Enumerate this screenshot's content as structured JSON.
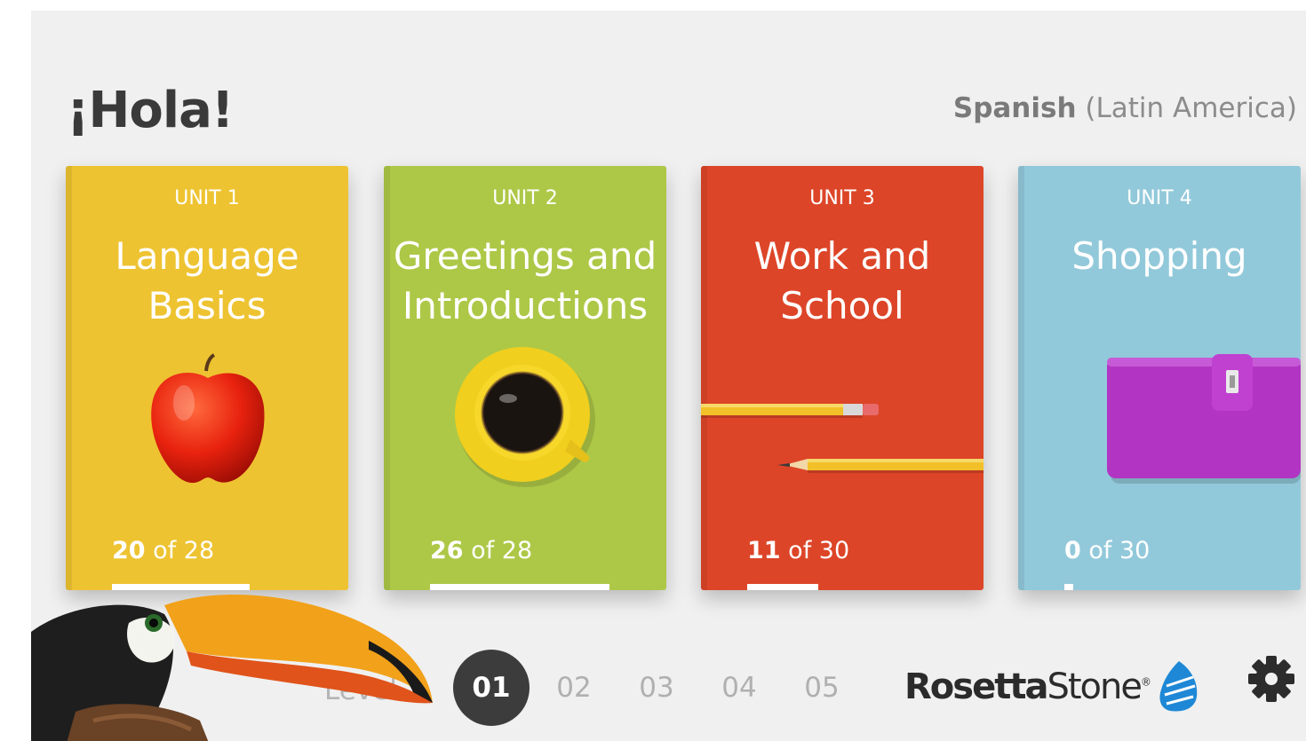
{
  "header": {
    "greeting": "¡Hola!",
    "language_name": "Spanish",
    "language_variant": "(Latin America)"
  },
  "units": [
    {
      "unit_label": "UNIT 1",
      "title_line1": "Language",
      "title_line2": "Basics",
      "completed": "20",
      "of_label": "of 28",
      "progress_fraction": 0.714,
      "color": "#eec331",
      "art": "apple-image"
    },
    {
      "unit_label": "UNIT 2",
      "title_line1": "Greetings and",
      "title_line2": "Introductions",
      "completed": "26",
      "of_label": "of 28",
      "progress_fraction": 0.929,
      "color": "#adc847",
      "art": "coffee-cup-image"
    },
    {
      "unit_label": "UNIT 3",
      "title_line1": "Work and",
      "title_line2": "School",
      "completed": "11",
      "of_label": "of 30",
      "progress_fraction": 0.367,
      "color": "#dd4528",
      "art": "pencils-image"
    },
    {
      "unit_label": "UNIT 4",
      "title_line1": "Shopping",
      "title_line2": "",
      "completed": "0",
      "of_label": "of 30",
      "progress_fraction": 0.0,
      "color": "#92c9da",
      "art": "wallet-image"
    }
  ],
  "levels": {
    "label": "Level",
    "items": [
      "01",
      "02",
      "03",
      "04",
      "05"
    ],
    "selected": "01"
  },
  "branding": {
    "logo_text_bold": "Rosetta",
    "logo_text_regular": "Stone",
    "registered_mark": "®"
  },
  "icons": {
    "settings": "gear-icon",
    "mascot": "toucan-image"
  }
}
